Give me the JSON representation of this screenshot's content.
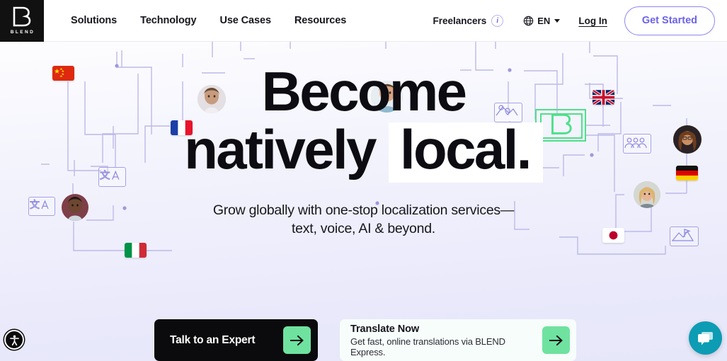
{
  "brand": {
    "logo_letter": "B",
    "logo_word": "BLEND",
    "accent_green": "#6FE2A0",
    "accent_purple": "#6C63E8",
    "chat_teal": "#0C9CB4",
    "hero_bg": "#E8E8FB"
  },
  "header": {
    "nav": [
      {
        "label": "Solutions"
      },
      {
        "label": "Technology"
      },
      {
        "label": "Use Cases"
      },
      {
        "label": "Resources"
      }
    ],
    "freelancers_label": "Freelancers",
    "info_icon": "info-icon",
    "info_glyph": "i",
    "globe_icon": "globe-icon",
    "language_code": "EN",
    "login_label": "Log In",
    "get_started_label": "Get Started"
  },
  "hero": {
    "headline_line1": "Become",
    "headline_line2_plain": "natively",
    "headline_line2_highlight": "local.",
    "subhead_line1": "Grow globally with one-stop localization services—",
    "subhead_line2": "text, voice, AI & beyond."
  },
  "ctas": {
    "primary_label": "Talk to an Expert",
    "primary_arrow_icon": "arrow-right-icon",
    "secondary_title": "Translate Now",
    "secondary_subtitle": "Get fast, online translations via BLEND Express.",
    "secondary_arrow_icon": "arrow-right-icon"
  },
  "widgets": {
    "accessibility_icon": "accessibility-icon",
    "chat_icon": "chat-bubbles-icon"
  },
  "decor": {
    "flags": [
      "china-flag",
      "france-flag",
      "italy-flag",
      "uk-flag",
      "germany-flag",
      "japan-flag"
    ],
    "icons": [
      "translate-icon",
      "translate-icon",
      "map-pin-icon",
      "blend-b-icon",
      "people-group-icon",
      "flag-mountain-icon"
    ],
    "avatars": [
      "avatar-person-1",
      "avatar-person-2",
      "avatar-person-3",
      "avatar-person-4",
      "avatar-person-5"
    ]
  }
}
